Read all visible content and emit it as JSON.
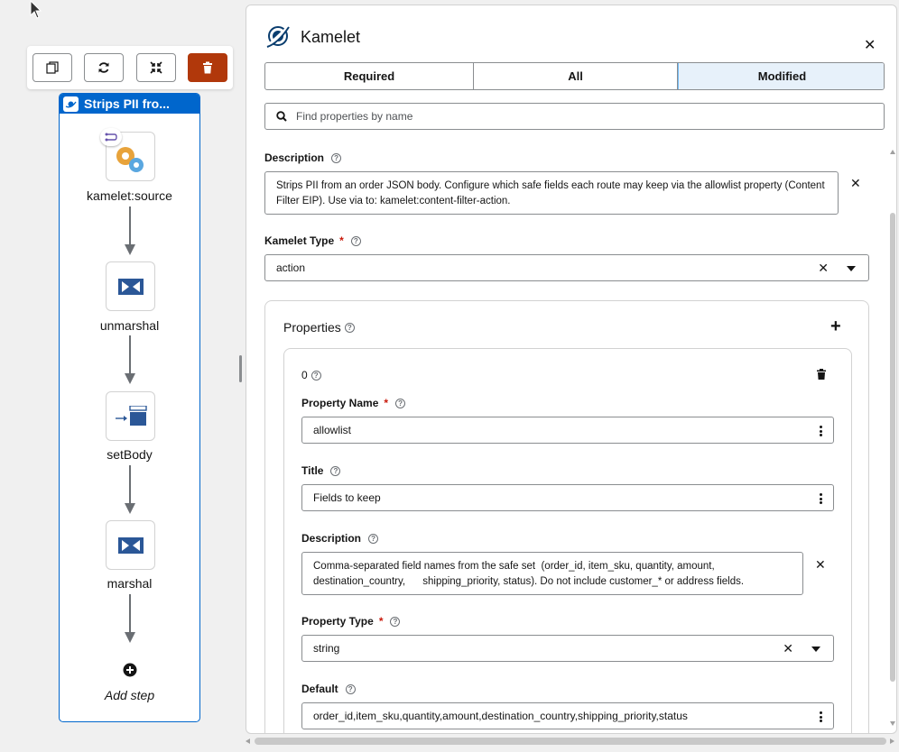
{
  "toolbar": {
    "buttons": [
      {
        "name": "duplicate",
        "icon": "copy-icon"
      },
      {
        "name": "replace",
        "icon": "refresh-icon"
      },
      {
        "name": "collapse",
        "icon": "compress-icon"
      },
      {
        "name": "delete",
        "icon": "trash-icon",
        "color": "#b1380b"
      }
    ]
  },
  "route": {
    "title": "Strips PII fro...",
    "steps": [
      {
        "label": "kamelet:source",
        "icon": "kamelet-gear-icon"
      },
      {
        "label": "unmarshal",
        "icon": "data-format-icon"
      },
      {
        "label": "setBody",
        "icon": "set-body-icon"
      },
      {
        "label": "marshal",
        "icon": "data-format-icon"
      }
    ],
    "add_step_label": "Add step"
  },
  "panel": {
    "title": "Kamelet",
    "tabs": [
      "Required",
      "All",
      "Modified"
    ],
    "active_tab": "Modified",
    "search_placeholder": "Find properties by name",
    "description_label": "Description",
    "description_value": "Strips PII from an order JSON body. Configure which safe fields each route may keep via the allowlist property (Content Filter EIP). Use via to: kamelet:content-filter-action.",
    "kamelet_type_label": "Kamelet Type",
    "kamelet_type_value": "action",
    "properties_label": "Properties",
    "property": {
      "index": "0",
      "name_label": "Property Name",
      "name_value": "allowlist",
      "title_label": "Title",
      "title_value": "Fields to keep",
      "description_label": "Description",
      "description_value": "Comma-separated field names from the safe set  (order_id, item_sku, quantity, amount, destination_country,      shipping_priority, status). Do not include customer_* or address fields.",
      "type_label": "Property Type",
      "type_value": "string",
      "default_label": "Default",
      "default_value": "order_id,item_sku,quantity,amount,destination_country,shipping_priority,status"
    }
  },
  "colors": {
    "accent": "#0066cc",
    "danger": "#b1380b",
    "active_tab": "#e7f1fa",
    "required": "#c9190b"
  }
}
